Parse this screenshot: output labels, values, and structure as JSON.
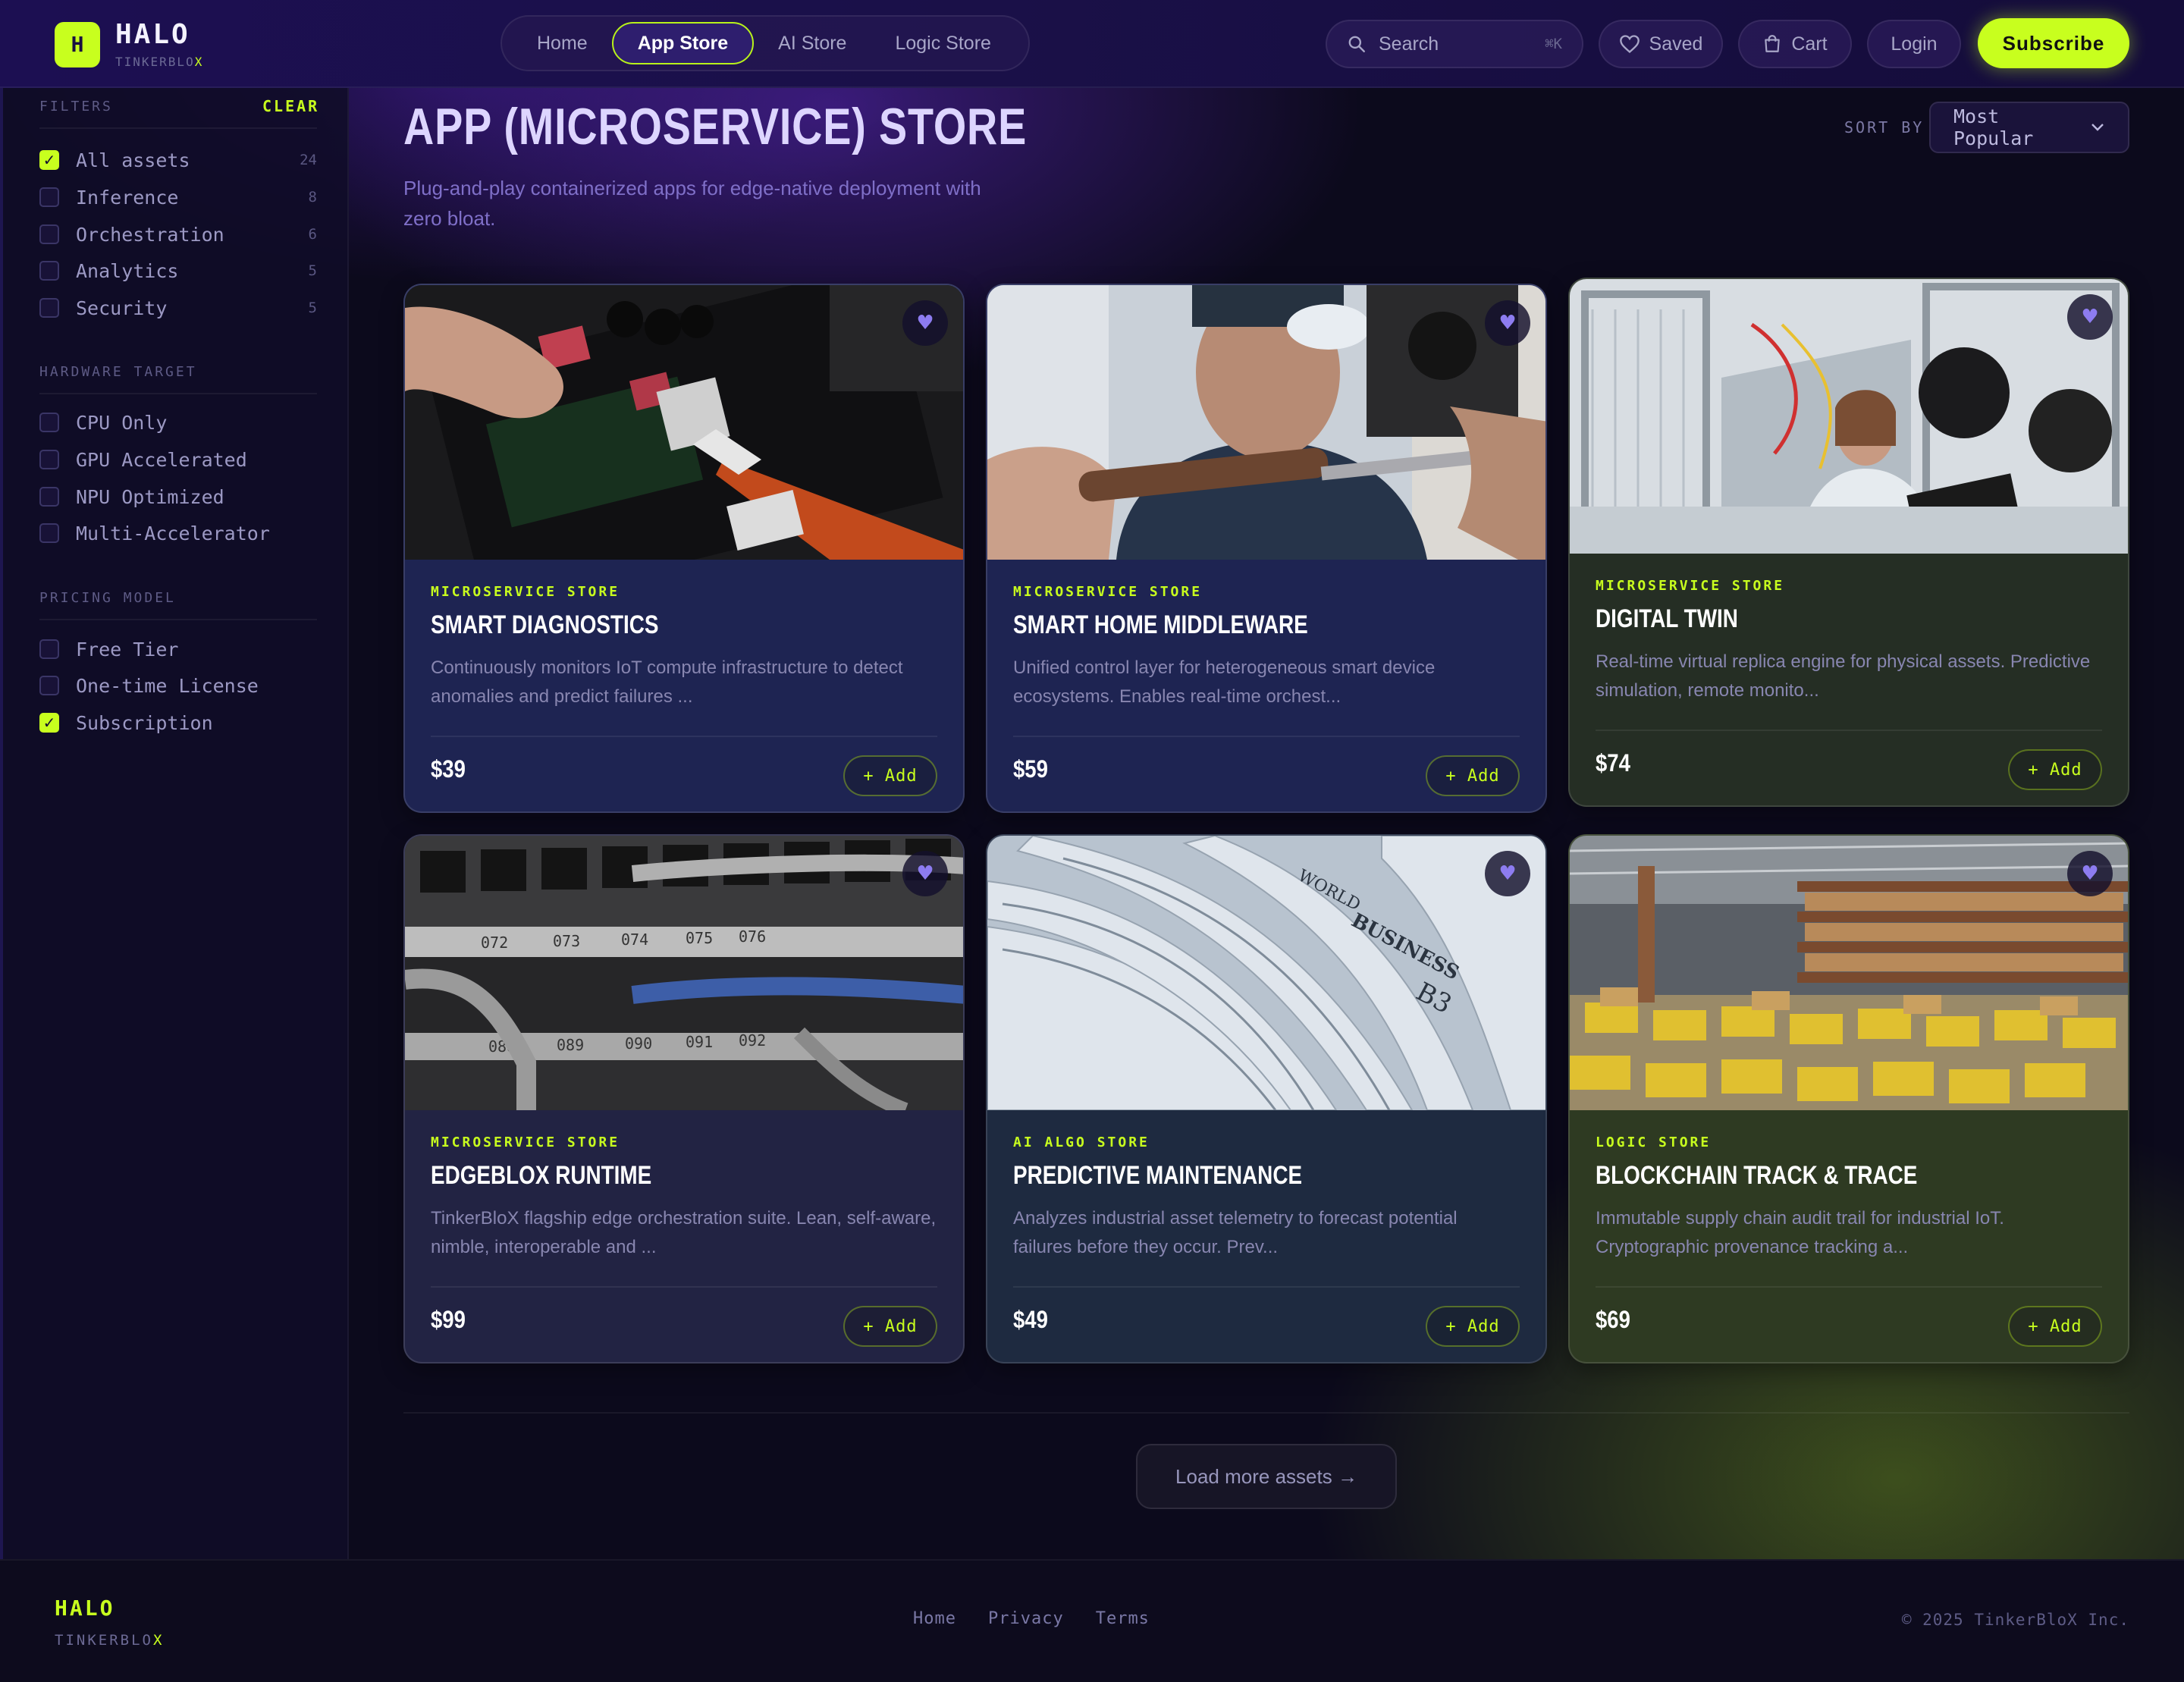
{
  "brand": {
    "mark": "H",
    "name": "HALO",
    "sub": "TINKERBLO",
    "sub_x": "X"
  },
  "nav": {
    "items": [
      "Home",
      "App Store",
      "AI Store",
      "Logic Store"
    ],
    "active": "App Store"
  },
  "search": {
    "label": "Search",
    "shortcut": "⌘K"
  },
  "header_buttons": {
    "saved": "Saved",
    "cart": "Cart",
    "login": "Login",
    "subscribe": "Subscribe"
  },
  "sidebar": {
    "filters_heading": "FILTERS",
    "clear_label": "CLEAR",
    "categories": [
      {
        "label": "All assets",
        "count": "24",
        "checked": true
      },
      {
        "label": "Inference",
        "count": "8",
        "checked": false
      },
      {
        "label": "Orchestration",
        "count": "6",
        "checked": false
      },
      {
        "label": "Analytics",
        "count": "5",
        "checked": false
      },
      {
        "label": "Security",
        "count": "5",
        "checked": false
      }
    ],
    "hardware_heading": "HARDWARE TARGET",
    "hardware": [
      {
        "label": "CPU Only",
        "checked": false
      },
      {
        "label": "GPU Accelerated",
        "checked": false
      },
      {
        "label": "NPU Optimized",
        "checked": false
      },
      {
        "label": "Multi-Accelerator",
        "checked": false
      }
    ],
    "pricing_heading": "PRICING MODEL",
    "pricing": [
      {
        "label": "Free Tier",
        "checked": false
      },
      {
        "label": "One-time License",
        "checked": false
      },
      {
        "label": "Subscription",
        "checked": true
      }
    ]
  },
  "main": {
    "title": "APP (MICROSERVICE) STORE",
    "subtitle": "Plug-and-play containerized apps for edge-native deployment with zero bloat.",
    "sort_label": "SORT BY",
    "sort_value": "Most Popular"
  },
  "cards": [
    {
      "category": "MICROSERVICE STORE",
      "title": "SMART DIAGNOSTICS",
      "description": "Continuously monitors IoT compute infrastructure to detect anomalies and predict failures ...",
      "price": "$39",
      "add_label": "+ Add",
      "image": "circuit-board-soldering-photo"
    },
    {
      "category": "MICROSERVICE STORE",
      "title": "SMART HOME MIDDLEWARE",
      "description": "Unified control layer for heterogeneous smart device ecosystems. Enables real-time orchest...",
      "price": "$59",
      "add_label": "+ Add",
      "image": "technician-soldering-photo"
    },
    {
      "category": "MICROSERVICE STORE",
      "title": "DIGITAL TWIN",
      "description": "Real-time virtual replica engine for physical assets. Predictive simulation, remote monito...",
      "price": "$74",
      "add_label": "+ Add",
      "image": "engineer-lab-laptop-photo"
    },
    {
      "category": "MICROSERVICE STORE",
      "title": "EDGEBLOX RUNTIME",
      "description": "TinkerBloX flagship edge orchestration suite. Lean, self-aware, nimble, interoperable and ...",
      "price": "$99",
      "add_label": "+ Add",
      "image": "network-patch-panel-photo",
      "port_labels": [
        "072",
        "073",
        "074",
        "075",
        "076",
        "088",
        "089",
        "090",
        "091",
        "092"
      ]
    },
    {
      "category": "AI ALGO STORE",
      "title": "PREDICTIVE MAINTENANCE",
      "description": "Analyzes industrial asset telemetry to forecast potential failures before they occur. Prev...",
      "price": "$49",
      "add_label": "+ Add",
      "image": "newspaper-stack-photo",
      "photo_text": [
        "WORLD",
        "BUSINESS",
        "B3"
      ]
    },
    {
      "category": "LOGIC STORE",
      "title": "BLOCKCHAIN TRACK & TRACE",
      "description": "Immutable supply chain audit trail for industrial IoT. Cryptographic provenance tracking a...",
      "price": "$69",
      "add_label": "+ Add",
      "image": "warehouse-shelves-photo"
    }
  ],
  "load_more": "Load more assets →",
  "footer": {
    "name": "HALO",
    "sub": "TINKERBLO",
    "sub_x": "X",
    "links": [
      "Home",
      "Privacy",
      "Terms"
    ],
    "copyright": "© 2025 TinkerBloX Inc."
  },
  "colors": {
    "accent": "#c8ff1e",
    "header_bg": "#1c0f52",
    "page_bg": "#0c0a1c",
    "card_bg": "#1e2452"
  }
}
